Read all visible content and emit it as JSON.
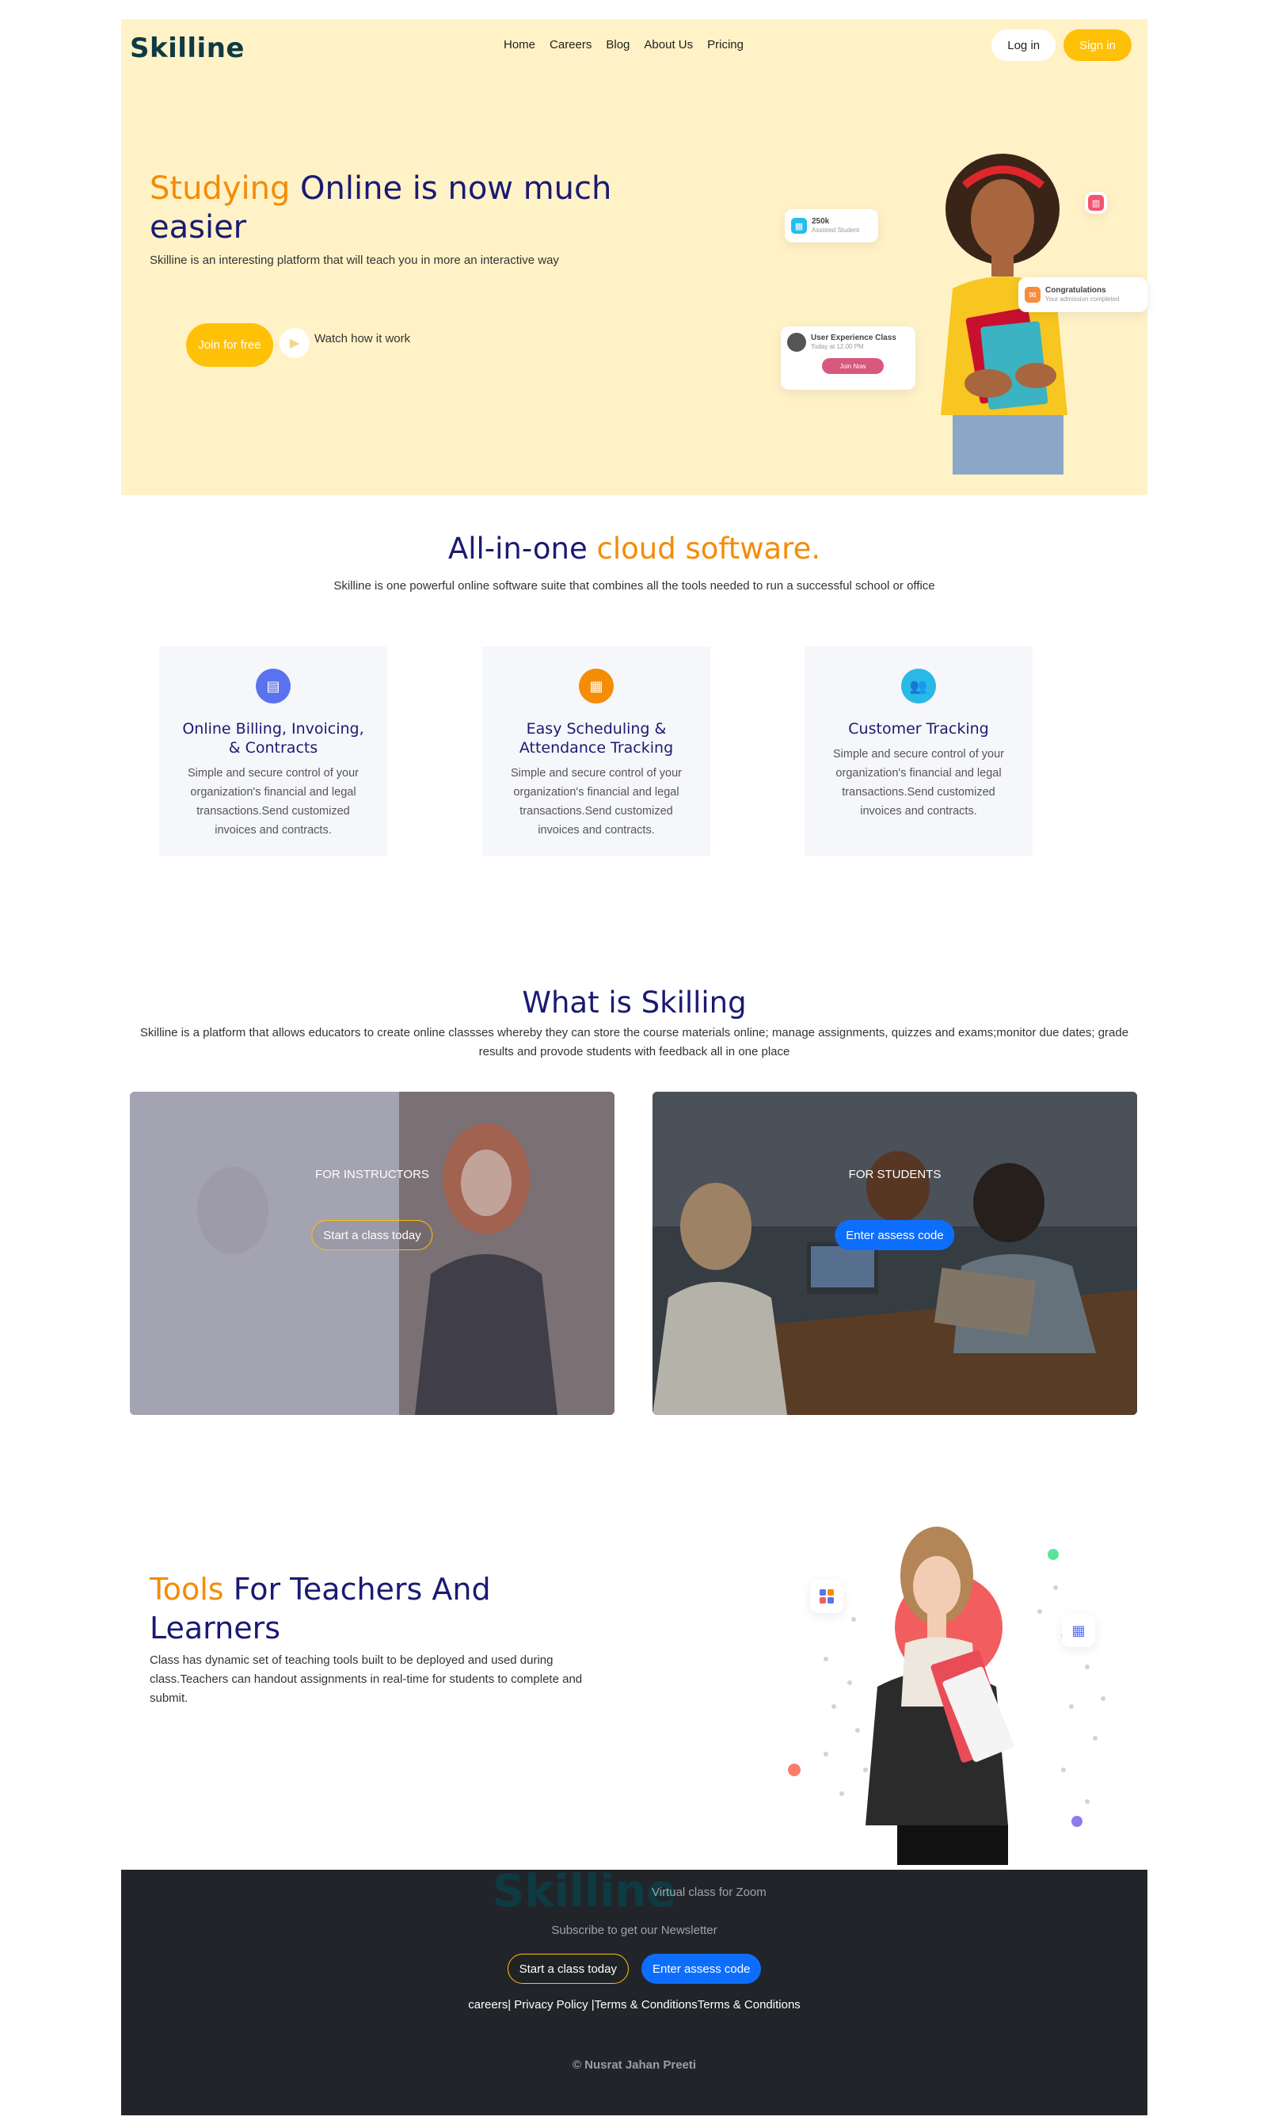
{
  "brand": {
    "logo": "Skilline"
  },
  "nav": {
    "items": [
      "Home",
      "Careers",
      "Blog",
      "About Us",
      "Pricing"
    ],
    "login": "Log in",
    "signin": "Sign in"
  },
  "hero": {
    "title_accent": "Studying",
    "title_rest": " Online is now much easier",
    "subtitle": "Skilline is an interesting platform that will teach you in more an interactive way",
    "join_button": "Join for free",
    "watch_label": "Watch how it work",
    "cards": {
      "students_count": "250k",
      "students_label": "Assisted Student",
      "congrats_title": "Congratulations",
      "congrats_sub": "Your admission completed",
      "class_title": "User Experience Class",
      "class_time": "Today at 12.00 PM",
      "class_button": "Join Now"
    }
  },
  "allinone": {
    "title_main": "All-in-one",
    "title_accent": " cloud software.",
    "subtitle": "Skilline is one powerful online software suite that combines all the tools needed to run a successful school or office",
    "cards": [
      {
        "title": "Online Billing, Invoicing, & Contracts",
        "text": "Simple and secure control of your organization's financial and legal transactions.Send customized invoices and contracts.",
        "icon": "document-icon",
        "color": "#5B72EE"
      },
      {
        "title": "Easy Scheduling & Attendance Tracking",
        "text": "Simple and secure control of your organization's financial and legal transactions.Send customized invoices and contracts.",
        "icon": "calendar-icon",
        "color": "#F48C06"
      },
      {
        "title": "Customer Tracking",
        "text": "Simple and secure control of your organization's financial and legal transactions.Send customized invoices and contracts.",
        "icon": "users-icon",
        "color": "#29B9E7"
      }
    ]
  },
  "skilling": {
    "title": "What is Skilling",
    "subtitle": "Skilline is a platform that allows educators to create online classses whereby they can store the course materials online; manage assignments, quizzes and exams;monitor due dates; grade results and provode students with feedback all in one place",
    "instructors": {
      "label": "FOR INSTRUCTORS",
      "button": "Start a class today"
    },
    "students": {
      "label": "FOR STUDENTS",
      "button": "Enter assess code"
    }
  },
  "tools": {
    "title_accent": "Tools",
    "title_rest": " For Teachers And Learners",
    "subtitle": "Class has dynamic set of teaching tools built to be deployed and used during class.Teachers can handout assignments in real-time for students to complete and submit."
  },
  "footer": {
    "logo": "Skilline",
    "tagline": "Virtual class for Zoom",
    "newsletter": "Subscribe to get our Newsletter",
    "btn_class": "Start a class today",
    "btn_code": "Enter assess code",
    "links": "careers| Privacy Policy |Terms & ConditionsTerms & Conditions",
    "copyright": "© Nusrat Jahan Preeti"
  },
  "colors": {
    "accent": "#F48C06",
    "navy": "#1A1A73",
    "yellow": "#FFC107",
    "hero_bg": "#FFF2C7",
    "footer_bg": "#212529",
    "blue": "#0D6EFD"
  }
}
